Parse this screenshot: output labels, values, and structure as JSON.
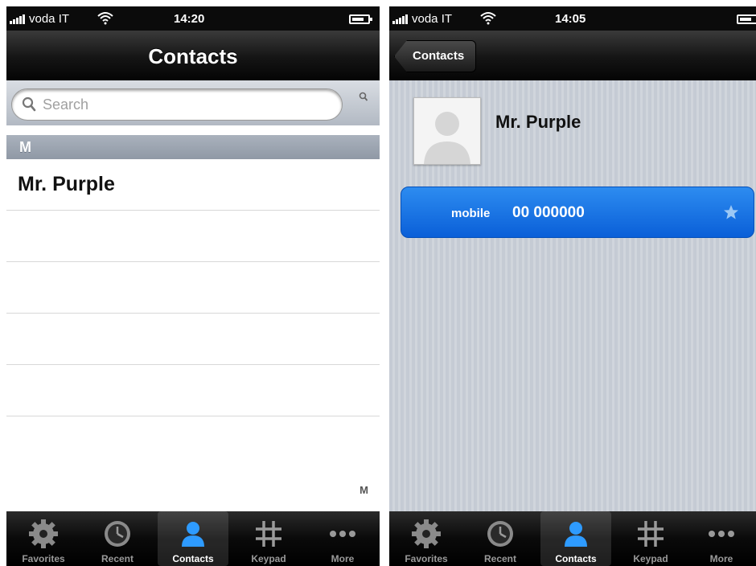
{
  "contacts_screen": {
    "status_bar": {
      "carrier": "voda IT",
      "time": "14:20"
    },
    "nav": {
      "title": "Contacts"
    },
    "search": {
      "placeholder": "Search"
    },
    "section_letter": "M",
    "contacts": [
      "Mr. Purple",
      "",
      "",
      "",
      "",
      ""
    ],
    "index_letter": "M"
  },
  "detail_screen": {
    "status_bar": {
      "carrier": "voda IT",
      "time": "14:05"
    },
    "nav": {
      "back_label": "Contacts"
    },
    "contact": {
      "name": "Mr. Purple",
      "phone_label": "mobile",
      "phone_number": "00 000000"
    }
  },
  "tab_bar": {
    "tabs": [
      {
        "label": "Favorites",
        "icon": "gear-icon"
      },
      {
        "label": "Recent",
        "icon": "clock-icon"
      },
      {
        "label": "Contacts",
        "icon": "person-icon"
      },
      {
        "label": "Keypad",
        "icon": "keypad-icon"
      },
      {
        "label": "More",
        "icon": "more-icon"
      }
    ],
    "active_tab": "Contacts"
  },
  "colors": {
    "accent_blue": "#1a73e8",
    "active_tab_icon": "#2e9bff"
  }
}
